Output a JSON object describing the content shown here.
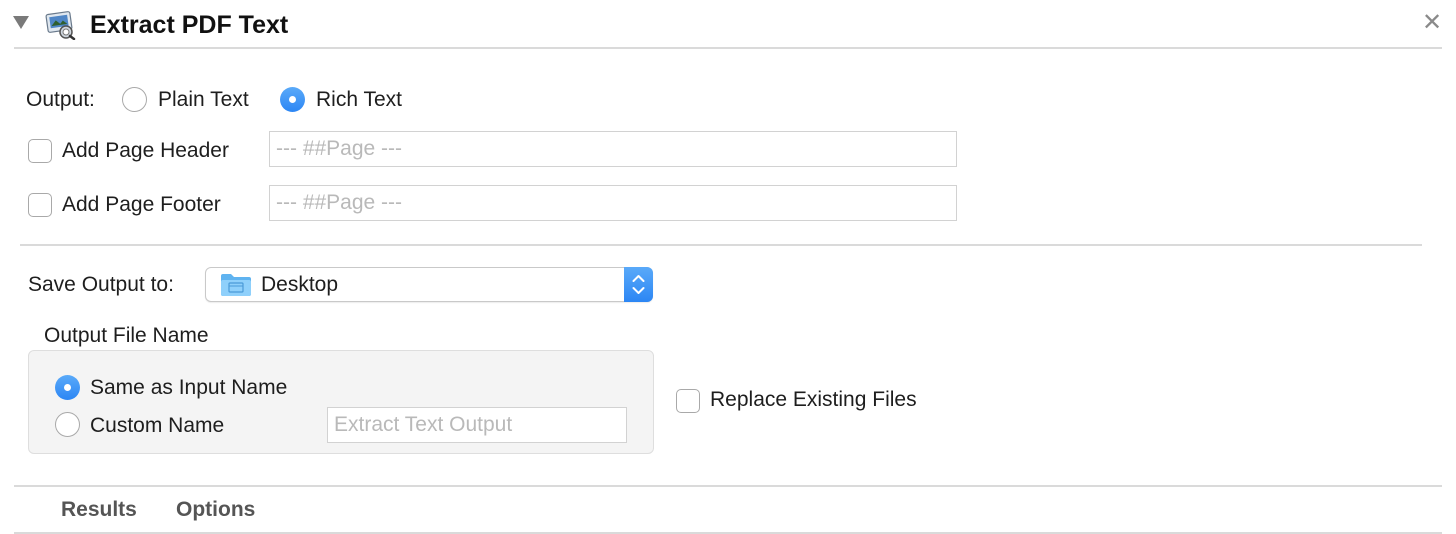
{
  "header": {
    "title": "Extract PDF Text",
    "icons": {
      "disclosure": "disclosure-triangle-down-icon",
      "action": "pdf-preview-action-icon",
      "close": "close-x-icon"
    }
  },
  "output": {
    "label": "Output:",
    "options": [
      {
        "label": "Plain Text",
        "selected": false
      },
      {
        "label": "Rich Text",
        "selected": true
      }
    ]
  },
  "page_header": {
    "label": "Add Page Header",
    "checked": false,
    "placeholder": "--- ##Page ---"
  },
  "page_footer": {
    "label": "Add Page Footer",
    "checked": false,
    "placeholder": "--- ##Page ---"
  },
  "save_output": {
    "label": "Save Output to:",
    "value": "Desktop",
    "icon": "folder-icon"
  },
  "file_name": {
    "group_label": "Output File Name",
    "options": [
      {
        "label": "Same as Input Name",
        "selected": true
      },
      {
        "label": "Custom Name",
        "selected": false
      }
    ],
    "custom_placeholder": "Extract Text Output"
  },
  "replace_existing": {
    "label": "Replace Existing Files",
    "checked": false
  },
  "tabs": [
    {
      "label": "Results"
    },
    {
      "label": "Options"
    }
  ],
  "colors": {
    "accent": "#3a93f7",
    "divider": "#dadada",
    "placeholder": "#b9b9b9",
    "group_background": "#f4f4f4"
  }
}
